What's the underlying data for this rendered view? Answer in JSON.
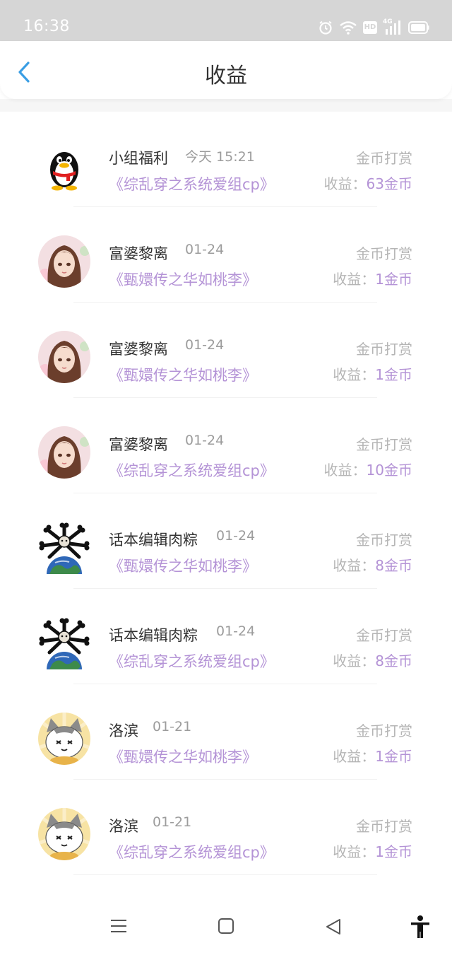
{
  "status_bar": {
    "time": "16:38",
    "icons": [
      "alarm-icon",
      "wifi-icon",
      "hd-icon",
      "signal-4g-icon",
      "battery-icon"
    ],
    "hd_label": "HD",
    "network_label": "4G"
  },
  "header": {
    "back_icon": "chevron-left-icon",
    "title": "收益"
  },
  "records": [
    {
      "name": "小组福利",
      "date": "今天 15:21",
      "book": "《综乱穿之系统爱组cp》",
      "type": "金币打赏",
      "income_label": "收益：",
      "income_amount": "63金币",
      "avatar": "qq-penguin"
    },
    {
      "name": "富婆黎离",
      "date": "01-24",
      "book": "《甄嬛传之华如桃李》",
      "type": "金币打赏",
      "income_label": "收益：",
      "income_amount": "1金币",
      "avatar": "girl"
    },
    {
      "name": "富婆黎离",
      "date": "01-24",
      "book": "《甄嬛传之华如桃李》",
      "type": "金币打赏",
      "income_label": "收益：",
      "income_amount": "1金币",
      "avatar": "girl"
    },
    {
      "name": "富婆黎离",
      "date": "01-24",
      "book": "《综乱穿之系统爱组cp》",
      "type": "金币打赏",
      "income_label": "收益：",
      "income_amount": "10金币",
      "avatar": "girl"
    },
    {
      "name": "话本编辑肉粽",
      "date": "01-24",
      "book": "《甄嬛传之华如桃李》",
      "type": "金币打赏",
      "income_label": "收益：",
      "income_amount": "8金币",
      "avatar": "bones-earth"
    },
    {
      "name": "话本编辑肉粽",
      "date": "01-24",
      "book": "《综乱穿之系统爱组cp》",
      "type": "金币打赏",
      "income_label": "收益：",
      "income_amount": "8金币",
      "avatar": "bones-earth"
    },
    {
      "name": "洛滨",
      "date": "01-21",
      "book": "《甄嬛传之华如桃李》",
      "type": "金币打赏",
      "income_label": "收益：",
      "income_amount": "1金币",
      "avatar": "cat"
    },
    {
      "name": "洛滨",
      "date": "01-21",
      "book": "《综乱穿之系统爱组cp》",
      "type": "金币打赏",
      "income_label": "收益：",
      "income_amount": "1金币",
      "avatar": "cat"
    }
  ],
  "nav_bar": {
    "icons": [
      "menu-icon",
      "home-square-icon",
      "back-triangle-icon",
      "accessibility-icon"
    ]
  },
  "colors": {
    "accent_purple": "#b493d6",
    "back_blue": "#3a9ee4",
    "status_bar_bg": "#d6d6d6",
    "muted_text": "#b5b5b5"
  }
}
